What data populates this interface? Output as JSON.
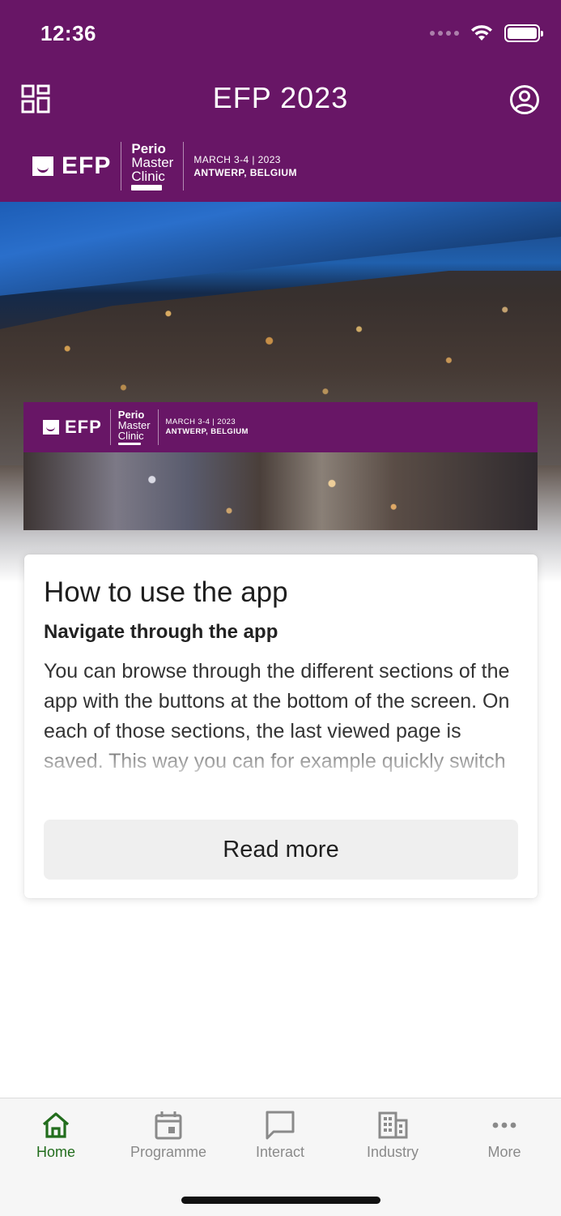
{
  "status_bar": {
    "time": "12:36"
  },
  "header": {
    "title": "EFP 2023",
    "logo": {
      "efp": "EFP",
      "perio_lines": [
        "Perio",
        "Master",
        "Clinic"
      ],
      "dates": "MARCH 3-4 | 2023",
      "place": "ANTWERP, BELGIUM"
    }
  },
  "banner": {
    "efp": "EFP",
    "perio_lines": [
      "Perio",
      "Master",
      "Clinic"
    ],
    "dates": "MARCH 3-4 | 2023",
    "place": "ANTWERP, BELGIUM"
  },
  "card": {
    "title": "How to use the app",
    "subtitle": "Navigate through the app",
    "body": "You can browse through the different sections of the app with the buttons at the bottom of the screen. On each of those sections, the last viewed page is saved. This way you can for example quickly switch between the programme",
    "read_more_label": "Read more"
  },
  "tabs": [
    {
      "label": "Home",
      "icon": "home-icon",
      "active": true
    },
    {
      "label": "Programme",
      "icon": "calendar-icon",
      "active": false
    },
    {
      "label": "Interact",
      "icon": "chat-icon",
      "active": false
    },
    {
      "label": "Industry",
      "icon": "building-icon",
      "active": false
    },
    {
      "label": "More",
      "icon": "more-icon",
      "active": false
    }
  ],
  "colors": {
    "brand": "#681666",
    "tab_active": "#226d1d",
    "tab_inactive": "#8a8a8a"
  }
}
